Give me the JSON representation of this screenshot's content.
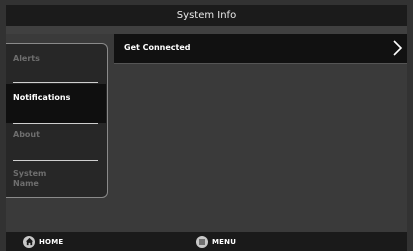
{
  "window": {
    "title": "System Info"
  },
  "sidebar": {
    "items": [
      {
        "label": "Alerts",
        "active": false
      },
      {
        "label": "Notifications",
        "active": true
      },
      {
        "label": "About",
        "active": false
      },
      {
        "label": "System Name",
        "active": false
      }
    ]
  },
  "main": {
    "rows": [
      {
        "label": "Get Connected"
      }
    ]
  },
  "bottom_bar": {
    "home_label": "HOME",
    "menu_label": "MENU"
  },
  "icons": {
    "home": "home-icon",
    "menu": "menu-icon",
    "chevron": "chevron-right-icon"
  },
  "colors": {
    "background": "#323232",
    "title_bar": "#1b1b1b",
    "active_item": "#0f0f0f",
    "inactive_text": "#6e6e6e",
    "text": "#ffffff"
  }
}
